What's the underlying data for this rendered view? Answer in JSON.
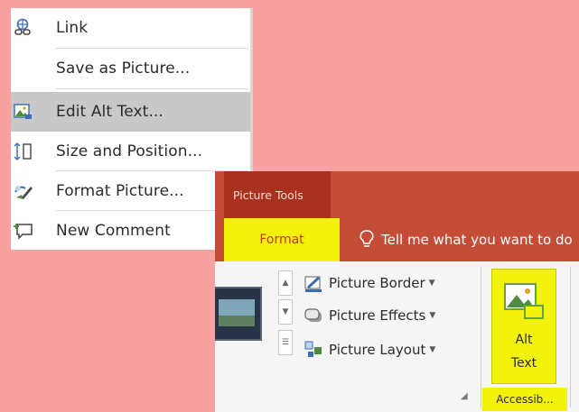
{
  "context_menu": {
    "items": [
      {
        "label": "Link",
        "icon": "link-icon"
      },
      {
        "label": "Save as Picture...",
        "icon": ""
      },
      {
        "label": "Edit Alt Text...",
        "icon": "alt-text-icon",
        "highlighted": true
      },
      {
        "label": "Size and Position...",
        "icon": "size-position-icon"
      },
      {
        "label": "Format Picture...",
        "icon": "format-picture-icon"
      },
      {
        "label": "New Comment",
        "icon": "comment-icon"
      }
    ]
  },
  "ribbon": {
    "contextual_label": "Picture Tools",
    "active_tab": "Format",
    "tell_me": "Tell me what you want to do",
    "commands": [
      {
        "label": "Picture Border",
        "icon": "picture-border-icon"
      },
      {
        "label": "Picture Effects",
        "icon": "picture-effects-icon"
      },
      {
        "label": "Picture Layout",
        "icon": "picture-layout-icon"
      }
    ],
    "alt_text_button": {
      "line1": "Alt",
      "line2": "Text"
    },
    "group_label": "Accessib..."
  },
  "colors": {
    "background": "#f7a1a1",
    "highlight_yellow": "#f2f20a",
    "ribbon_red": "#c44d37",
    "picture_tools_dark": "#a8311f"
  }
}
